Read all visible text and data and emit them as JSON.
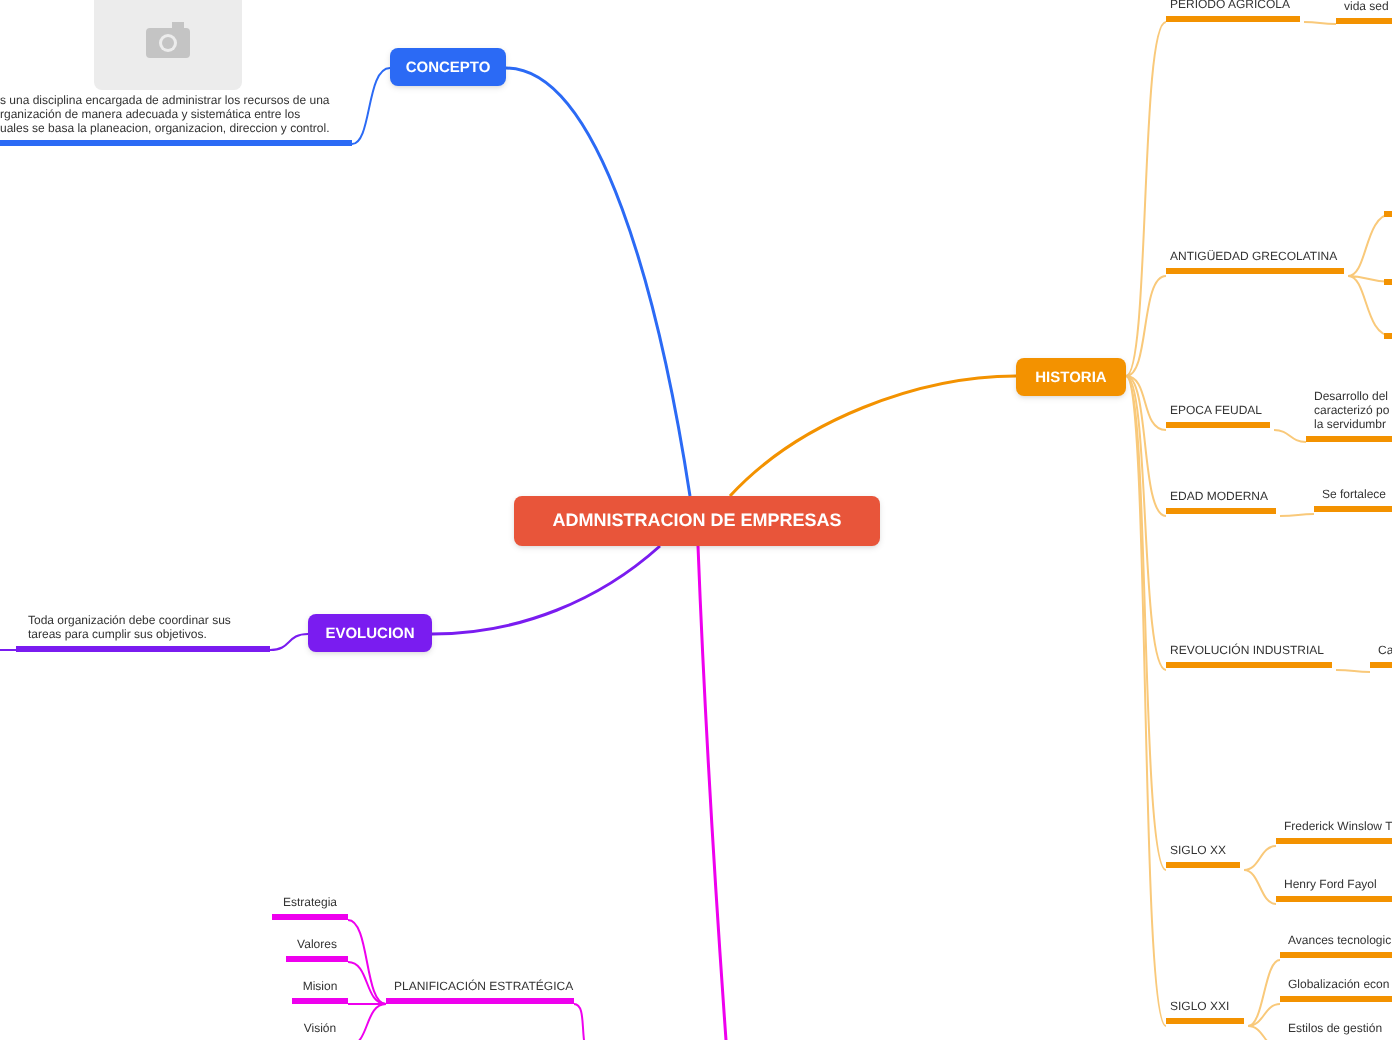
{
  "central": {
    "label": "ADMNISTRACION DE EMPRESAS"
  },
  "concept": {
    "label": "CONCEPTO",
    "color": "#2b6af5",
    "text": "s una disciplina encargada de administrar los recursos de una\nrganización de manera adecuada y sistemática entre los\nuales se basa la planeacion, organizacion, direccion y control."
  },
  "history": {
    "label": "HISTORIA",
    "color": "#f39200",
    "children": [
      {
        "label": "PERIODO AGRICOLA",
        "children": [
          {
            "label": "vida sed"
          }
        ]
      },
      {
        "label": "ANTIGÜEDAD GRECOLATINA"
      },
      {
        "label": "EPOCA FEUDAL",
        "children": [
          {
            "label": "Desarrollo del\ncaracterizó po\nla servidumbr"
          }
        ]
      },
      {
        "label": "EDAD MODERNA",
        "children": [
          {
            "label": "Se fortalece"
          }
        ]
      },
      {
        "label": "REVOLUCIÓN INDUSTRIAL",
        "children": [
          {
            "label": "Ca"
          }
        ]
      },
      {
        "label": "SIGLO XX",
        "children": [
          {
            "label": "Frederick Winslow T"
          },
          {
            "label": "Henry Ford Fayol"
          }
        ]
      },
      {
        "label": "SIGLO XXI",
        "children": [
          {
            "label": "Avances tecnologic"
          },
          {
            "label": "Globalización econ"
          },
          {
            "label": "Estilos de gestión"
          }
        ]
      }
    ]
  },
  "evolution": {
    "label": "EVOLUCION",
    "color": "#7a1cf0",
    "text": "Toda organización debe coordinar sus\ntareas para cumplir sus objetivos."
  },
  "planning": {
    "label": "PLANIFICACIÓN ESTRATÉGICA",
    "color": "#ee00ee",
    "children": [
      {
        "label": "Estrategia"
      },
      {
        "label": "Valores"
      },
      {
        "label": "Mision"
      },
      {
        "label": "Visión"
      }
    ]
  }
}
